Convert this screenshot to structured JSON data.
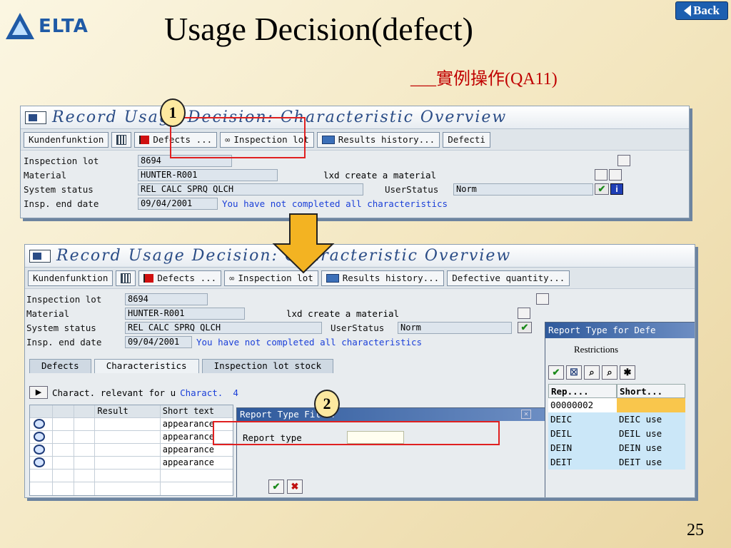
{
  "slide": {
    "logo_text": "ELTA",
    "title": "Usage Decision(defect)",
    "subtitle": "___實例操作(QA11)",
    "back_label": "Back",
    "page_number": "25",
    "callout_1": "1",
    "callout_2": "2"
  },
  "top_window": {
    "title": "Record Usage Decision: Characteristic Overview",
    "toolbar": {
      "kundenfunktion": "Kundenfunktion",
      "defects": "Defects ...",
      "inspection_lot": "Inspection lot",
      "results_history": "Results history...",
      "defective": "Defecti"
    },
    "fields": {
      "inspection_lot_label": "Inspection lot",
      "inspection_lot_value": "8694",
      "material_label": "Material",
      "material_value": "HUNTER-R001",
      "material_desc": "lxd create a material",
      "system_status_label": "System status",
      "system_status_value": "REL  CALC SPRQ QLCH",
      "user_status_label": "UserStatus",
      "user_status_value": "Norm",
      "end_date_label": "Insp. end date",
      "end_date_value": "09/04/2001",
      "message": "You have not completed all characteristics"
    }
  },
  "bottom_window": {
    "title": "Record Usage Decision: Characteristic Overview",
    "toolbar": {
      "kundenfunktion": "Kundenfunktion",
      "defects": "Defects ...",
      "inspection_lot": "Inspection lot",
      "results_history": "Results history...",
      "defective_quantity": "Defective quantity..."
    },
    "fields": {
      "inspection_lot_label": "Inspection lot",
      "inspection_lot_value": "8694",
      "material_label": "Material",
      "material_value": "HUNTER-R001",
      "material_desc": "lxd create a material",
      "system_status_label": "System status",
      "system_status_value": "REL  CALC SPRQ QLCH",
      "user_status_label": "UserStatus",
      "user_status_value": "Norm",
      "end_date_label": "Insp. end date",
      "end_date_value": "09/04/2001",
      "message": "You have not completed all characteristics"
    },
    "tabs": [
      "Defects",
      "Characteristics",
      "Inspection lot stock"
    ],
    "charact_header": "Charact. relevant for u",
    "charact_count_label": "Charact.",
    "charact_count": "4",
    "table": {
      "headers": [
        "Result",
        "Short text"
      ],
      "rows": [
        "appearance",
        "appearance",
        "appearance",
        "appearance"
      ]
    },
    "dialog": {
      "title": "Report Type Filter",
      "field_label": "Report type",
      "field_value": ""
    },
    "popup": {
      "title": "Report Type for Defe",
      "tab": "Restrictions",
      "col1": "Rep....",
      "col2": "Short...",
      "selected_code": "00000002",
      "selected_text": "",
      "rows": [
        {
          "code": "DEIC",
          "text": "DEIC use"
        },
        {
          "code": "DEIL",
          "text": "DEIL use"
        },
        {
          "code": "DEIN",
          "text": "DEIN use"
        },
        {
          "code": "DEIT",
          "text": "DEIT use"
        }
      ]
    }
  }
}
